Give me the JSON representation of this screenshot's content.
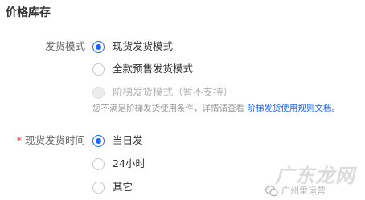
{
  "section": {
    "title": "价格库存"
  },
  "shipping_mode": {
    "label": "发货模式",
    "options": [
      {
        "label": "现货发货模式",
        "state": "checked"
      },
      {
        "label": "全款预售发货模式",
        "state": "unchecked"
      },
      {
        "label": "阶梯发货模式（暂不支持）",
        "state": "disabled"
      }
    ],
    "hint_text": "您不满足阶梯发货使用条件，详情请查看",
    "hint_link": "阶梯发货使用规则文档。"
  },
  "ship_time": {
    "required_mark": "*",
    "label": "现货发货时间",
    "options": [
      {
        "label": "当日发",
        "state": "checked"
      },
      {
        "label": "24小时",
        "state": "unchecked"
      },
      {
        "label": "其它",
        "state": "unchecked"
      }
    ]
  },
  "watermark": {
    "text": "广东龙网",
    "account": "广州雷运营",
    "icon": "wechat-icon"
  },
  "colors": {
    "accent": "#1766ff",
    "required": "#f5222d",
    "disabled": "#b3b3b3",
    "hint": "#9a9a9a"
  }
}
